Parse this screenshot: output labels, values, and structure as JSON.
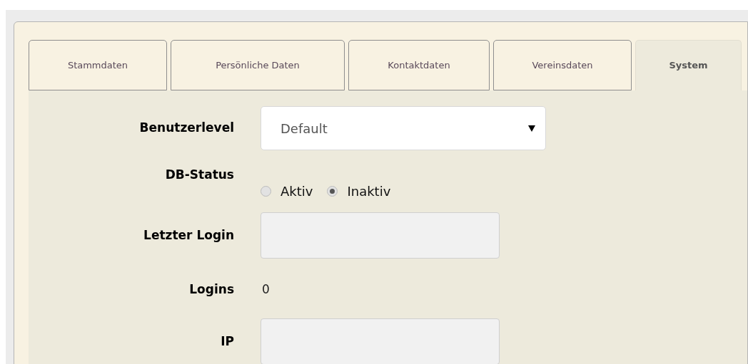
{
  "tabs": [
    {
      "label": "Stammdaten",
      "selected": false
    },
    {
      "label": "Persönliche Daten",
      "selected": false
    },
    {
      "label": "Kontaktdaten",
      "selected": false
    },
    {
      "label": "Vereinsdaten",
      "selected": false
    },
    {
      "label": "System",
      "selected": true
    }
  ],
  "form": {
    "rows": [
      {
        "kind": "select",
        "label": "Benutzerlevel",
        "value": "Default"
      },
      {
        "kind": "radio",
        "label": "DB-Status",
        "options": [
          {
            "label": "Aktiv",
            "selected": false
          },
          {
            "label": "Inaktiv",
            "selected": true
          }
        ]
      },
      {
        "kind": "input",
        "label": "Letzter Login"
      },
      {
        "kind": "text",
        "label": "Logins",
        "value": "0"
      },
      {
        "kind": "input",
        "label": "IP"
      }
    ]
  }
}
